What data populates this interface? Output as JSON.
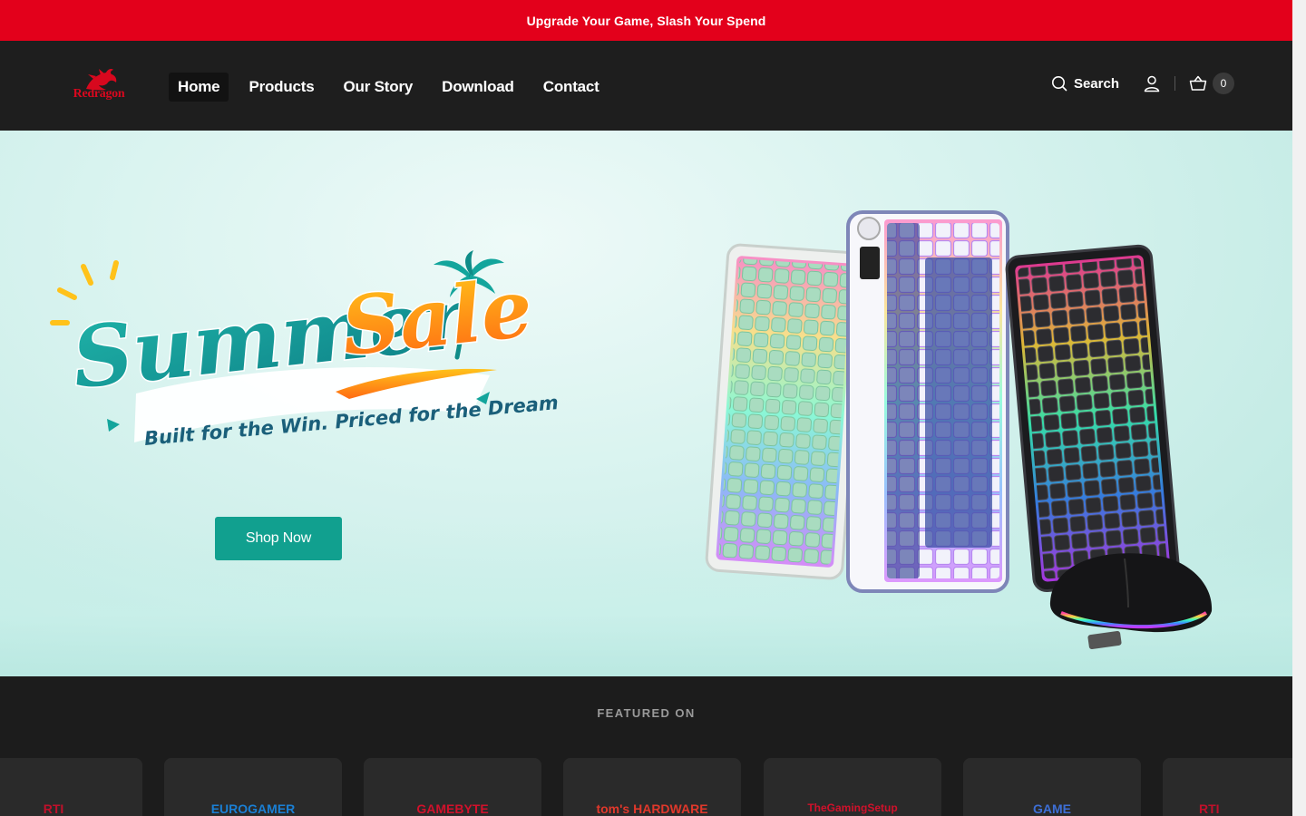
{
  "announcement": {
    "text": "Upgrade Your Game, Slash Your Spend"
  },
  "header": {
    "logo_text": "Redragon",
    "nav": [
      {
        "label": "Home",
        "active": true
      },
      {
        "label": "Products"
      },
      {
        "label": "Our Story"
      },
      {
        "label": "Download"
      },
      {
        "label": "Contact"
      }
    ],
    "search_label": "Search",
    "cart_count": "0"
  },
  "hero": {
    "headline_part1": "Summer",
    "headline_part2": "Sale",
    "tagline": "Built for the Win. Priced for the Dream",
    "cta_label": "Shop Now"
  },
  "featured": {
    "title": "FEATURED ON",
    "outlets": [
      {
        "name": "EUROGAMER",
        "color": "#1a7fd4"
      },
      {
        "name": "GAMEBYTE",
        "color": "#d0112b"
      },
      {
        "name": "tom's HARDWARE",
        "color": "#e0382b"
      },
      {
        "name": "TheGamingSetup",
        "color": "#d0112b"
      },
      {
        "name": "GAME",
        "color": "#3d6fd6"
      },
      {
        "name": "RTI",
        "color": "#c0102a"
      }
    ]
  },
  "colors": {
    "brand_red": "#e3001b",
    "accent_teal": "#11a08f",
    "header_bg": "#1e1e1e"
  }
}
